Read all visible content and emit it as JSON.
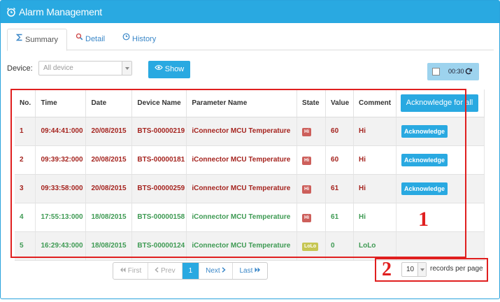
{
  "header": {
    "title": "Alarm Management",
    "icon": "alarm-clock-icon",
    "bg_color": "#29a9e1"
  },
  "tabs": [
    {
      "label": "Summary",
      "icon": "sigma-icon",
      "active": true
    },
    {
      "label": "Detail",
      "icon": "magnifier-icon",
      "active": false
    },
    {
      "label": "History",
      "icon": "history-clock-icon",
      "active": false
    }
  ],
  "filter": {
    "device_label": "Device:",
    "device_value": "All device",
    "show_label": "Show"
  },
  "refresh": {
    "timer": "00:30",
    "checked": false
  },
  "table": {
    "columns": [
      "No.",
      "Time",
      "Date",
      "Device Name",
      "Parameter Name",
      "State",
      "Value",
      "Comment"
    ],
    "ack_all_label": "Acknowledge for all",
    "rows": [
      {
        "no": "1",
        "time": "09:44:41:000",
        "date": "20/08/2015",
        "device": "BTS-00000219",
        "param": "iConnector MCU Temperature",
        "state": "Hi",
        "value": "60",
        "comment": "Hi",
        "ack": "Acknowledge"
      },
      {
        "no": "2",
        "time": "09:39:32:000",
        "date": "20/08/2015",
        "device": "BTS-00000181",
        "param": "iConnector MCU Temperature",
        "state": "Hi",
        "value": "60",
        "comment": "Hi",
        "ack": "Acknowledge"
      },
      {
        "no": "3",
        "time": "09:33:58:000",
        "date": "20/08/2015",
        "device": "BTS-00000259",
        "param": "iConnector MCU Temperature",
        "state": "Hi",
        "value": "61",
        "comment": "Hi",
        "ack": "Acknowledge"
      },
      {
        "no": "4",
        "time": "17:55:13:000",
        "date": "18/08/2015",
        "device": "BTS-00000158",
        "param": "iConnector MCU Temperature",
        "state": "Hi",
        "value": "61",
        "comment": "Hi",
        "ack": ""
      },
      {
        "no": "5",
        "time": "16:29:43:000",
        "date": "18/08/2015",
        "device": "BTS-00000124",
        "param": "iConnector MCU Temperature",
        "state": "LoLo",
        "value": "0",
        "comment": "LoLo",
        "ack": ""
      }
    ]
  },
  "pagination": {
    "first": "First",
    "prev": "Prev",
    "current": "1",
    "next": "Next",
    "last": "Last"
  },
  "page_size": {
    "value": "10",
    "label": "records per page"
  },
  "annotations": {
    "mark1": "1",
    "mark2": "2",
    "color": "#e01f1f"
  },
  "colors": {
    "alarm_active": "#a5241f",
    "alarm_cleared": "#3e9a53",
    "badge_hi": "#cd5f5b",
    "badge_lolo": "#c6c653"
  }
}
